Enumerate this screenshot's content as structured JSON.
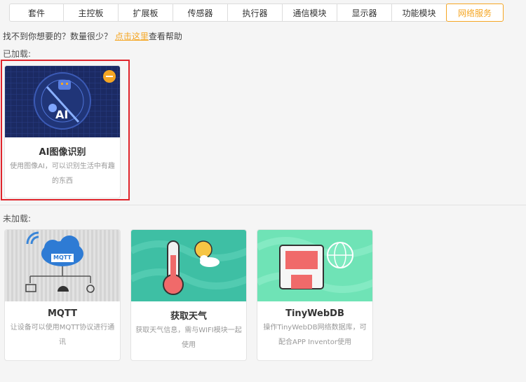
{
  "tabs": [
    {
      "label": "套件"
    },
    {
      "label": "主控板"
    },
    {
      "label": "扩展板"
    },
    {
      "label": "传感器"
    },
    {
      "label": "执行器"
    },
    {
      "label": "通信模块"
    },
    {
      "label": "显示器"
    },
    {
      "label": "功能模块"
    },
    {
      "label": "网络服务",
      "active": true
    }
  ],
  "help": {
    "prefix": "找不到你想要的？数量很少？ ",
    "link": "点击这里",
    "suffix": "查看帮助"
  },
  "loaded": {
    "label": "已加载:",
    "cards": [
      {
        "title": "AI图像识别",
        "desc": "使用图像AI，可以识别生活中有趣的东西",
        "image_text": "AI"
      }
    ]
  },
  "unloaded": {
    "label": "未加载:",
    "cards": [
      {
        "title": "MQTT",
        "desc": "让设备可以使用MQTT协议进行通讯",
        "image_text": "MQTT"
      },
      {
        "title": "获取天气",
        "desc": "获取天气信息，需与WIFI模块一起使用"
      },
      {
        "title": "TinyWebDB",
        "desc": "操作TinyWebDB网络数据库，可配合APP Inventor使用"
      }
    ]
  },
  "colors": {
    "accent": "#f5a623",
    "highlight": "#e0242b"
  }
}
